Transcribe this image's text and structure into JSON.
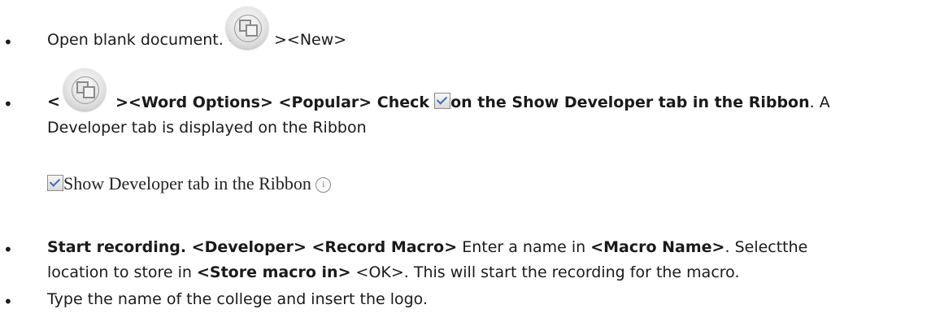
{
  "items": [
    {
      "parts": {
        "p1": "Open blank document. <",
        "p2": "><New>"
      }
    },
    {
      "parts": {
        "p1": "<",
        "p2": "><Word Options> <Popular> Check",
        "p3": "on the Show Developer tab in the Ribbon",
        "p4": ". A",
        "p5": "Developer tab is displayed on the Ribbon"
      }
    },
    {
      "parts": {
        "p1": "Start recording. <Developer> <Record Macro>",
        "p2": " Enter a name in ",
        "p3": "<Macro Name>",
        "p4": ". Selectthe",
        "p5": "location to store in ",
        "p6": "<Store macro in>",
        "p7": " <OK>. This will start the recording for the macro."
      }
    },
    {
      "parts": {
        "p1": "Type the name of the college and insert the logo."
      }
    }
  ],
  "checkbox_label": "Show Developer tab in the Ribbon",
  "bullet": "•",
  "icons": [
    "office-button-icon",
    "checkbox-icon",
    "info-icon"
  ]
}
